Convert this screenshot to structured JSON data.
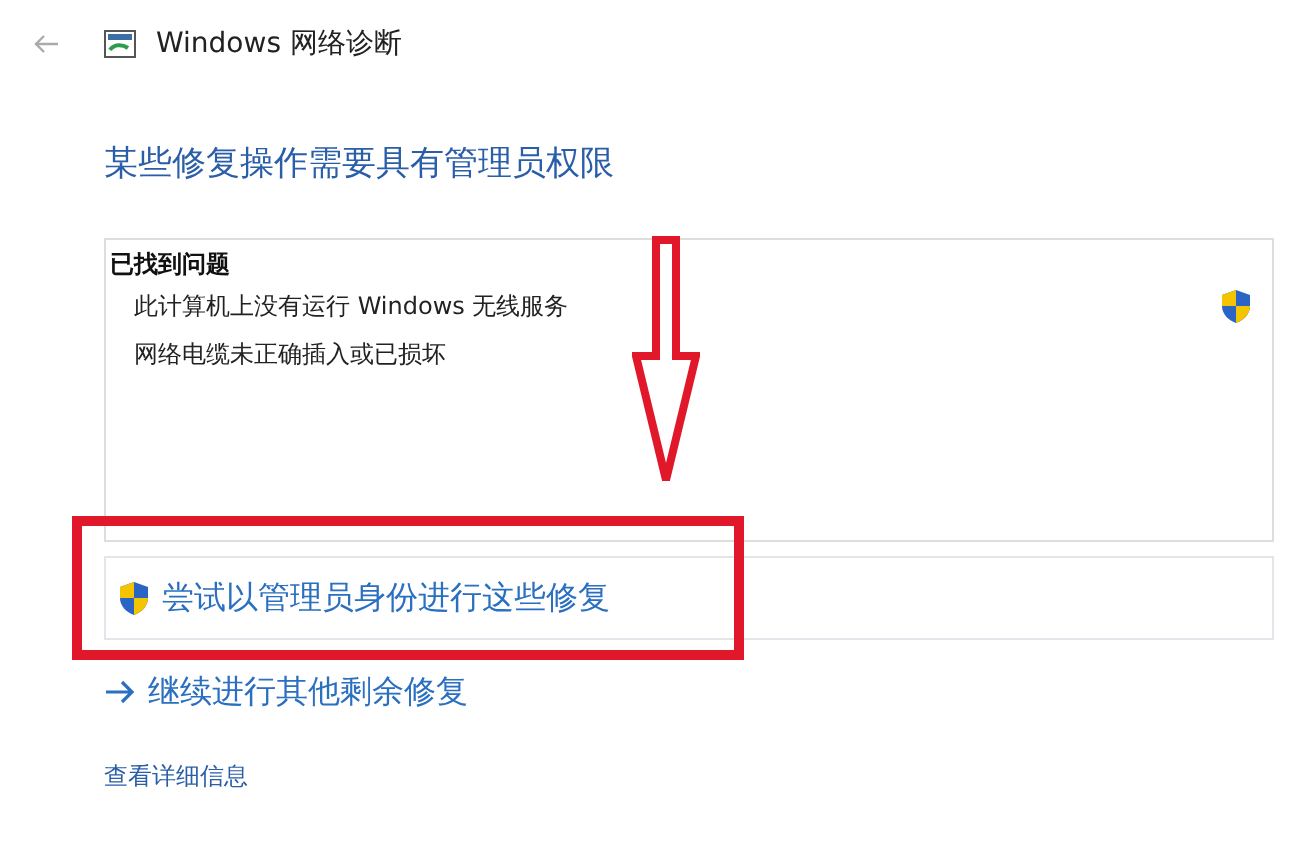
{
  "window": {
    "title": "Windows 网络诊断"
  },
  "heading": "某些修复操作需要具有管理员权限",
  "problems": {
    "title": "已找到问题",
    "items": [
      {
        "text": "此计算机上没有运行 Windows 无线服务",
        "requires_admin": true
      },
      {
        "text": "网络电缆未正确插入或已损坏",
        "requires_admin": false
      }
    ]
  },
  "options": [
    {
      "kind": "admin",
      "label": "尝试以管理员身份进行这些修复"
    },
    {
      "kind": "continue",
      "label": "继续进行其他剩余修复"
    }
  ],
  "details_link": "查看详细信息"
}
